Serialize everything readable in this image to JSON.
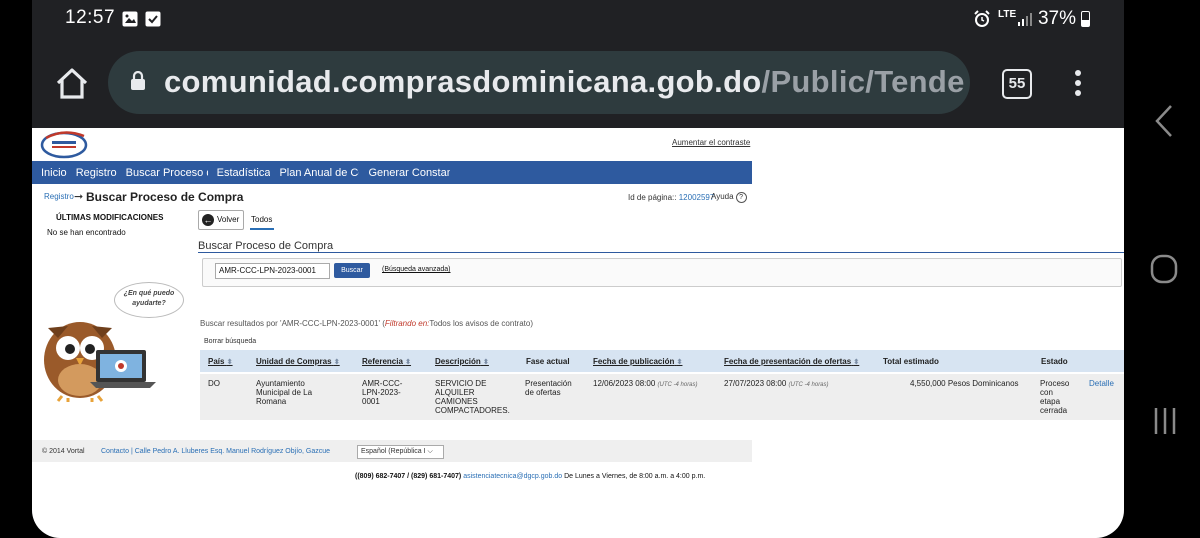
{
  "status_bar": {
    "time": "12:57",
    "network": "LTE",
    "battery": "37%"
  },
  "browser": {
    "url_host": "comunidad.comprasdominicana.gob.do",
    "url_path": "/Public/Tende",
    "tab_count": "55"
  },
  "header": {
    "contrast_link": "Aumentar el contraste"
  },
  "nav": {
    "items": [
      "Inicio",
      "Registro",
      "Buscar Proceso de",
      "Estadística",
      "Plan Anual de Com",
      "Generar Constanci"
    ]
  },
  "breadcrumb": {
    "root": "Registro",
    "current": "Buscar Proceso de Compra"
  },
  "page_id": {
    "label": "Id de página::",
    "value": "12002597",
    "help": "Ayuda"
  },
  "sidebar": {
    "title": "ÚLTIMAS MODIFICACIONES",
    "empty": "No se han encontrado"
  },
  "toolbar": {
    "back_label": "Volver",
    "tab_all": "Todos"
  },
  "search": {
    "title": "Buscar Proceso de Compra",
    "value": "AMR-CCC-LPN-2023-0001",
    "button": "Buscar",
    "advanced": "(Búsqueda avanzada)",
    "bubble_line1": "¿En qué puedo",
    "bubble_line2": "ayudarte?",
    "results_prefix": "Buscar resultados por 'AMR-CCC-LPN-2023-0001' (",
    "results_filter": "Filtrando en:",
    "results_suffix": "Todos los avisos de contrato)",
    "clear": "Borrar búsqueda"
  },
  "table": {
    "headers": [
      "País",
      "Unidad de Compras",
      "Referencia",
      "Descripción",
      "Fase actual",
      "Fecha de publicación",
      "Fecha de presentación de ofertas",
      "Total estimado",
      "Estado"
    ],
    "row": {
      "country": "DO",
      "unit": [
        "Ayuntamiento",
        "Municipal de La",
        "Romana"
      ],
      "reference": [
        "AMR-CCC-",
        "LPN-2023-",
        "0001"
      ],
      "description": [
        "SERVICIO DE",
        "ALQUILER",
        "CAMIONES",
        "COMPACTADORES."
      ],
      "phase": [
        "Presentación",
        "de ofertas"
      ],
      "pub_date": "12/06/2023 08:00",
      "pub_tz": "(UTC -4 horas)",
      "offer_date": "27/07/2023 08:00",
      "offer_tz": "(UTC -4 horas)",
      "total": "4,550,000 Pesos Dominicanos",
      "status": [
        "Proceso",
        "con",
        "etapa",
        "cerrada"
      ],
      "detail": "Detalle"
    }
  },
  "footer": {
    "copyright": "© 2014 Vortal",
    "contact": "Contacto | Calle Pedro A. Lluberes Esq. Manuel Rodríguez Objío, Gazcue",
    "language": "Español (República I",
    "phones": "((809) 682-7407 / (829) 681-7407)",
    "email": "asistenciatecnica@dgcp.gob.do",
    "hours": "De Lunes a Viernes, de 8:00 a.m. a 4:00 p.m."
  },
  "icons": [
    "image-icon",
    "check-square-icon",
    "alarm-icon",
    "signal-icon",
    "battery-icon",
    "home-icon",
    "lock-icon",
    "tabs-icon",
    "more-vert-icon",
    "back-arrow-icon",
    "help-icon",
    "sort-icon",
    "owl-mascot",
    "recent-apps-icon",
    "home-nav-icon",
    "back-nav-icon"
  ],
  "colors": {
    "nav_blue": "#2e5a9f",
    "table_header": "#d7e4f2",
    "link": "#2a6fb5"
  }
}
